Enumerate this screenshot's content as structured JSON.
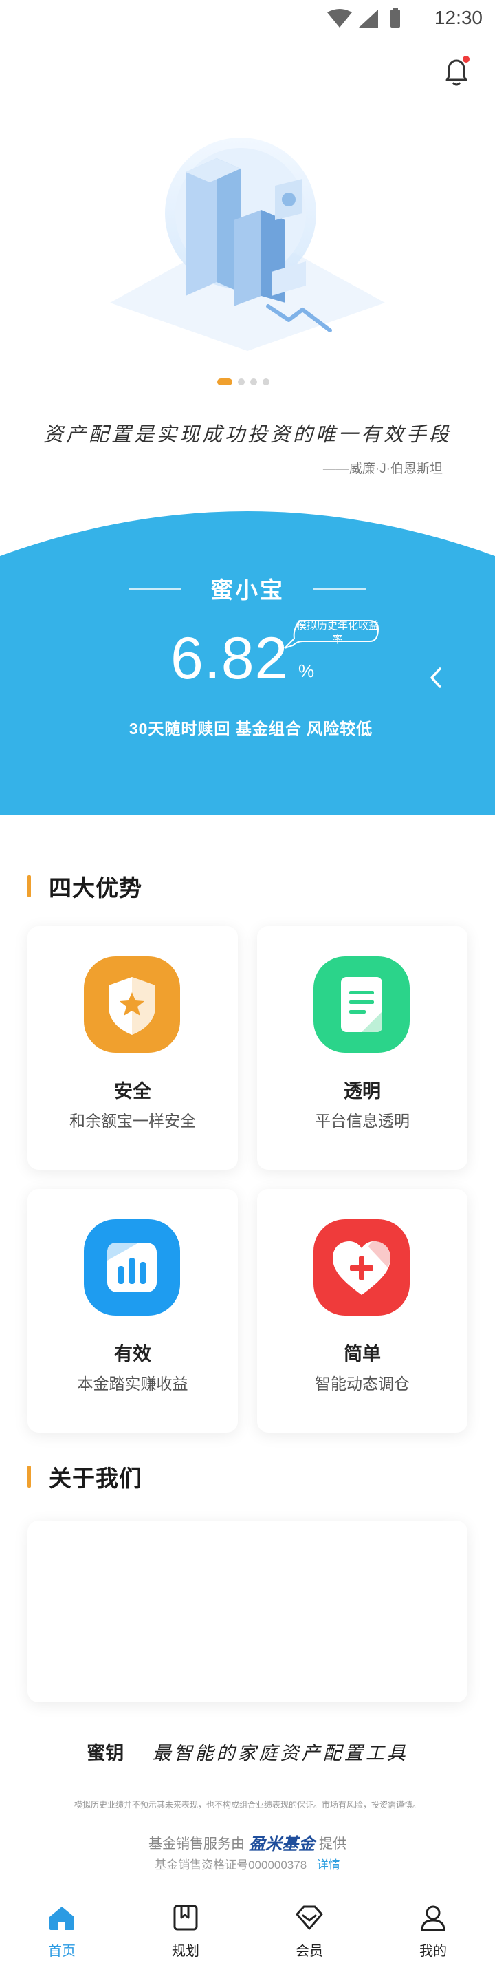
{
  "status_bar": {
    "time": "12:30"
  },
  "carousel": {
    "pages": 4,
    "active_index": 0
  },
  "quote": {
    "text": "资产配置是实现成功投资的唯一有效手段",
    "author": "——威廉·J·伯恩斯坦"
  },
  "product": {
    "name": "蜜小宝",
    "rate": "6.82",
    "rate_unit": "%",
    "rate_tag": "模拟历史年化收益率",
    "description": "30天随时赎回 基金组合 风险较低",
    "accent_color": "#35b2e8"
  },
  "advantages": {
    "title": "四大优势",
    "items": [
      {
        "icon": "shield-star-icon",
        "title": "安全",
        "desc": "和余额宝一样安全",
        "color": "#f0a02e"
      },
      {
        "icon": "document-icon",
        "title": "透明",
        "desc": "平台信息透明",
        "color": "#2bd48a"
      },
      {
        "icon": "bar-chart-icon",
        "title": "有效",
        "desc": "本金踏实赚收益",
        "color": "#1e9cf0"
      },
      {
        "icon": "heart-plus-icon",
        "title": "简单",
        "desc": "智能动态调仓",
        "color": "#ef3b3b"
      }
    ]
  },
  "about": {
    "title": "关于我们"
  },
  "footer": {
    "brand": "蜜钥",
    "slogan": "最智能的家庭资产配置工具",
    "disclaimer": "模拟历史业绩并不预示其未来表现，也不构成组合业绩表现的保证。市场有风险，投资需谨慎。",
    "provider_prefix": "基金销售服务由",
    "provider_name": "盈米基金",
    "provider_suffix": "提供",
    "license": "基金销售资格证号000000378",
    "license_link": "详情"
  },
  "tabbar": {
    "items": [
      {
        "label": "首页",
        "icon": "home-icon",
        "active": true
      },
      {
        "label": "规划",
        "icon": "bookmark-icon",
        "active": false
      },
      {
        "label": "会员",
        "icon": "diamond-icon",
        "active": false
      },
      {
        "label": "我的",
        "icon": "user-icon",
        "active": false
      }
    ],
    "active_color": "#2b9be3"
  }
}
